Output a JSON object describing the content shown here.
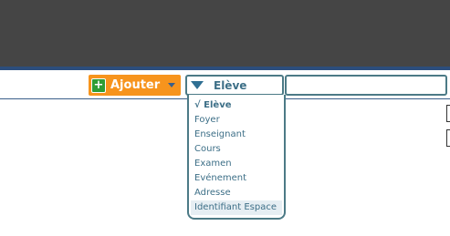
{
  "toolbar": {
    "add_button": {
      "label": "Ajouter",
      "icon": "plus-icon",
      "icon_glyph": "+",
      "caret_icon": "caret-down-icon"
    },
    "type_select": {
      "selected_label": "Elève",
      "icon": "triangle-down-icon"
    },
    "search_input": {
      "value": "",
      "placeholder": ""
    }
  },
  "dropdown": {
    "selected_marker": "√",
    "items": [
      {
        "label": "Elève",
        "selected": true
      },
      {
        "label": "Foyer"
      },
      {
        "label": "Enseignant"
      },
      {
        "label": "Cours"
      },
      {
        "label": "Examen"
      },
      {
        "label": "Evénement"
      },
      {
        "label": "Adresse"
      },
      {
        "label": "Identifiant Espace",
        "hovered": true
      }
    ]
  },
  "colors": {
    "header_bg": "#454545",
    "header_accent": "#2c4d7c",
    "add_button_bg": "#f7941d",
    "plus_icon_bg": "#2e9d35",
    "select_border": "#4c7a86",
    "item_text": "#3d6f87",
    "hover_bg": "#e6eef3"
  }
}
